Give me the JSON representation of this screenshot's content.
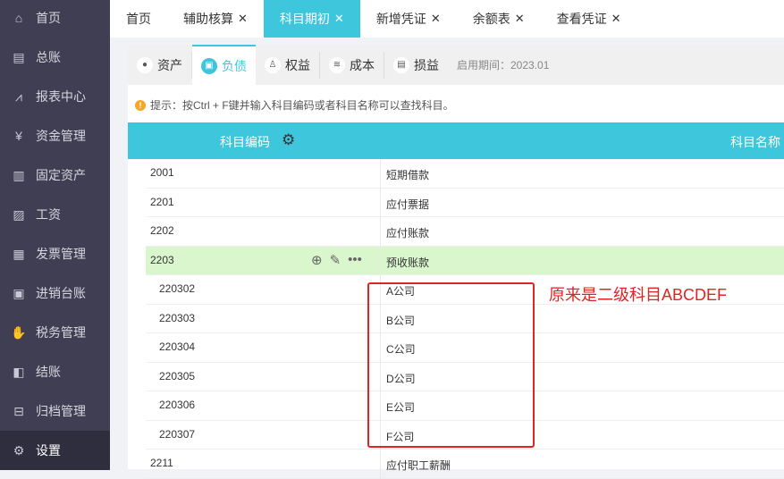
{
  "sidebar": {
    "items": [
      {
        "label": "首页",
        "icon": "home-icon"
      },
      {
        "label": "总账",
        "icon": "ledger-icon"
      },
      {
        "label": "报表中心",
        "icon": "chart-icon"
      },
      {
        "label": "资金管理",
        "icon": "money-bag-icon"
      },
      {
        "label": "固定资产",
        "icon": "building-icon"
      },
      {
        "label": "工资",
        "icon": "salary-icon"
      },
      {
        "label": "发票管理",
        "icon": "invoice-icon"
      },
      {
        "label": "进销台账",
        "icon": "inventory-icon"
      },
      {
        "label": "税务管理",
        "icon": "tax-icon"
      },
      {
        "label": "结账",
        "icon": "close-book-icon"
      },
      {
        "label": "归档管理",
        "icon": "archive-icon"
      },
      {
        "label": "设置",
        "icon": "gear-icon"
      }
    ]
  },
  "tabs": [
    {
      "label": "首页"
    },
    {
      "label": "辅助核算"
    },
    {
      "label": "科目期初"
    },
    {
      "label": "新增凭证"
    },
    {
      "label": "余额表"
    },
    {
      "label": "查看凭证"
    }
  ],
  "subtabs": [
    {
      "label": "资产"
    },
    {
      "label": "负债"
    },
    {
      "label": "权益"
    },
    {
      "label": "成本"
    },
    {
      "label": "损益"
    }
  ],
  "period": "启用期间：2023.01",
  "hint": "提示：按Ctrl + F键并输入科目编码或者科目名称可以查找科目。",
  "table": {
    "headers": [
      "科目编码",
      "科目名称"
    ],
    "rows": [
      {
        "code": "2001",
        "name": "短期借款"
      },
      {
        "code": "2201",
        "name": "应付票据"
      },
      {
        "code": "2202",
        "name": "应付账款"
      },
      {
        "code": "2203",
        "name": "预收账款"
      },
      {
        "code": "220302",
        "name": "A公司"
      },
      {
        "code": "220303",
        "name": "B公司"
      },
      {
        "code": "220304",
        "name": "C公司"
      },
      {
        "code": "220305",
        "name": "D公司"
      },
      {
        "code": "220306",
        "name": "E公司"
      },
      {
        "code": "220307",
        "name": "F公司"
      },
      {
        "code": "2211",
        "name": "应付职工薪酬"
      }
    ]
  },
  "annotation": "原来是二级科目ABCDEF",
  "colors": {
    "accent": "#3ec6dc",
    "sidebar": "#3f3e52",
    "highlight": "#d9f6cd",
    "annotation": "#e52222"
  }
}
